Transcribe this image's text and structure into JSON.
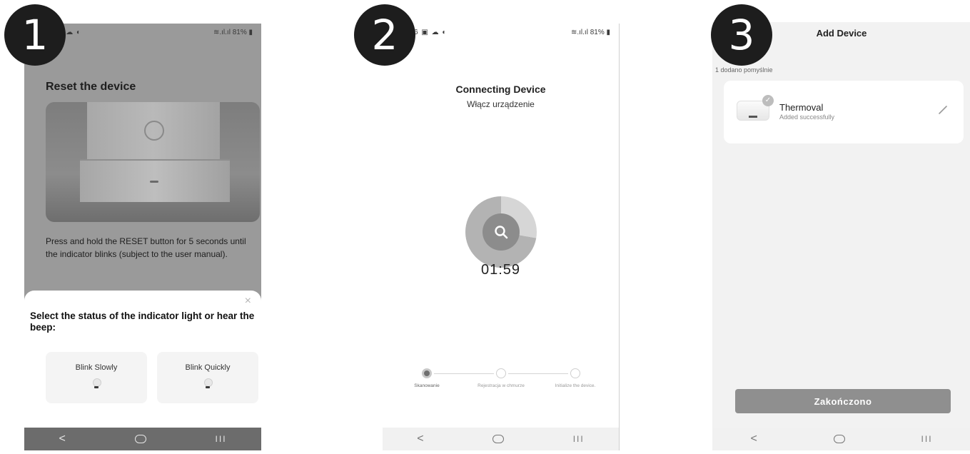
{
  "steps": [
    "1",
    "2",
    "3"
  ],
  "phone1": {
    "status_left": "▣ ☁ ◐",
    "status_right": "≋.ıl.ıl 81% ▮",
    "title": "Reset the device",
    "description": "Press and hold the RESET button for 5 seconds until the indicator blinks (subject to the user manual).",
    "sheet_title": "Select the status of the indicator light or hear the beep:",
    "close_label": "×",
    "options": [
      "Blink Slowly",
      "Blink Quickly"
    ]
  },
  "phone2": {
    "status_left": "6 ▣ ☁ ◐",
    "status_right": "≋.ıl.ıl 81% ▮",
    "title": "Connecting Device",
    "subtitle": "Włącz urządzenie",
    "timer": "01:59",
    "progress_steps": [
      {
        "label": "Skanowanie",
        "state": "active"
      },
      {
        "label": "Rejestracja w chmurze",
        "state": "pending"
      },
      {
        "label": "Initialize the device.",
        "state": "pending"
      }
    ]
  },
  "phone3": {
    "title": "Add Device",
    "count_text": "1 dodano pomyślnie",
    "device_name": "Thermoval",
    "device_status": "Added successfully",
    "finish_label": "Zakończono"
  },
  "nav": {
    "back": "<",
    "recent": "III"
  },
  "colors": {
    "accent_gray": "#8f8f8f",
    "dark_badge": "#1d1d1d"
  },
  "icons": [
    "search-icon",
    "edit-icon",
    "check-icon",
    "close-icon",
    "bulb-icon",
    "power-icon"
  ]
}
